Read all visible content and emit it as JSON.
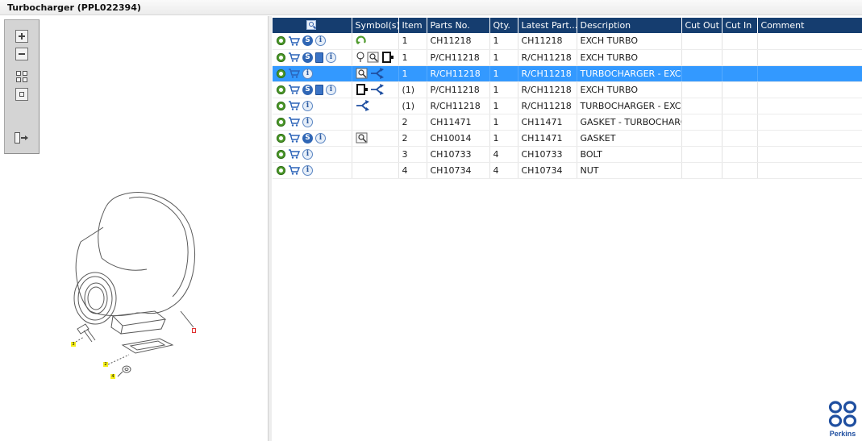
{
  "window": {
    "title": "Turbocharger (PPL022394)"
  },
  "illustration": {
    "callouts": [
      "3",
      "2",
      "4"
    ],
    "colors": {
      "outline": "#555555",
      "callout_bg": "#f4ee1a",
      "callout_red": "#e03030"
    }
  },
  "viewer_toolbar": {
    "buttons": [
      "zoom-in-icon",
      "zoom-out-icon",
      "fit-grid-icon",
      "fit-box-icon",
      "export-icon"
    ]
  },
  "grid": {
    "columns": [
      "",
      "Symbol(s)",
      "Item",
      "Parts No.",
      "Qty.",
      "Latest Part...",
      "Description",
      "Cut Out",
      "Cut In",
      "Comment"
    ],
    "header_color": "#153d6f",
    "selected_color": "#3399ff",
    "rows": [
      {
        "item": "1",
        "part_no": "CH11218",
        "qty": "1",
        "latest": "CH11218",
        "description": "EXCH TURBO",
        "cut_out": "",
        "cut_in": "",
        "comment": "",
        "selected": false,
        "icons": [
          "gear-icon",
          "cart-icon",
          "s-icon",
          "info-icon"
        ],
        "symbols": [
          "refresh-icon"
        ]
      },
      {
        "item": "1",
        "part_no": "P/CH11218",
        "qty": "1",
        "latest": "R/CH11218",
        "description": "EXCH TURBO",
        "cut_out": "",
        "cut_in": "",
        "comment": "",
        "selected": false,
        "icons": [
          "gear-icon",
          "cart-icon",
          "s-icon",
          "book-icon",
          "info-icon"
        ],
        "symbols": [
          "pin-icon",
          "view-icon",
          "doc-black-icon"
        ]
      },
      {
        "item": "1",
        "part_no": "R/CH11218",
        "qty": "1",
        "latest": "R/CH11218",
        "description": "TURBOCHARGER - EXCHANGE",
        "cut_out": "",
        "cut_in": "",
        "comment": "",
        "selected": true,
        "icons": [
          "gear-icon",
          "cart-icon",
          "info-icon"
        ],
        "symbols": [
          "view-icon",
          "branch-icon"
        ]
      },
      {
        "item": "(1)",
        "part_no": "P/CH11218",
        "qty": "1",
        "latest": "R/CH11218",
        "description": "EXCH TURBO",
        "cut_out": "",
        "cut_in": "",
        "comment": "",
        "selected": false,
        "icons": [
          "gear-icon",
          "cart-icon",
          "s-icon",
          "book-icon",
          "info-icon"
        ],
        "symbols": [
          "doc-black-icon",
          "branch-icon"
        ]
      },
      {
        "item": "(1)",
        "part_no": "R/CH11218",
        "qty": "1",
        "latest": "R/CH11218",
        "description": "TURBOCHARGER - EXCHANGE",
        "cut_out": "",
        "cut_in": "",
        "comment": "",
        "selected": false,
        "icons": [
          "gear-icon",
          "cart-icon",
          "info-icon"
        ],
        "symbols": [
          "branch-icon"
        ]
      },
      {
        "item": "2",
        "part_no": "CH11471",
        "qty": "1",
        "latest": "CH11471",
        "description": "GASKET - TURBOCHARGER",
        "cut_out": "",
        "cut_in": "",
        "comment": "",
        "selected": false,
        "icons": [
          "gear-icon",
          "cart-icon",
          "info-icon"
        ],
        "symbols": []
      },
      {
        "item": "2",
        "part_no": "CH10014",
        "qty": "1",
        "latest": "CH11471",
        "description": "GASKET",
        "cut_out": "",
        "cut_in": "",
        "comment": "",
        "selected": false,
        "icons": [
          "gear-icon",
          "cart-icon",
          "s-icon",
          "info-icon"
        ],
        "symbols": [
          "view-icon"
        ]
      },
      {
        "item": "3",
        "part_no": "CH10733",
        "qty": "4",
        "latest": "CH10733",
        "description": "BOLT",
        "cut_out": "",
        "cut_in": "",
        "comment": "",
        "selected": false,
        "icons": [
          "gear-icon",
          "cart-icon",
          "info-icon"
        ],
        "symbols": []
      },
      {
        "item": "4",
        "part_no": "CH10734",
        "qty": "4",
        "latest": "CH10734",
        "description": "NUT",
        "cut_out": "",
        "cut_in": "",
        "comment": "",
        "selected": false,
        "icons": [
          "gear-icon",
          "cart-icon",
          "info-icon"
        ],
        "symbols": []
      }
    ]
  },
  "brand": {
    "name": "Perkins",
    "color": "#1f4fa0"
  }
}
